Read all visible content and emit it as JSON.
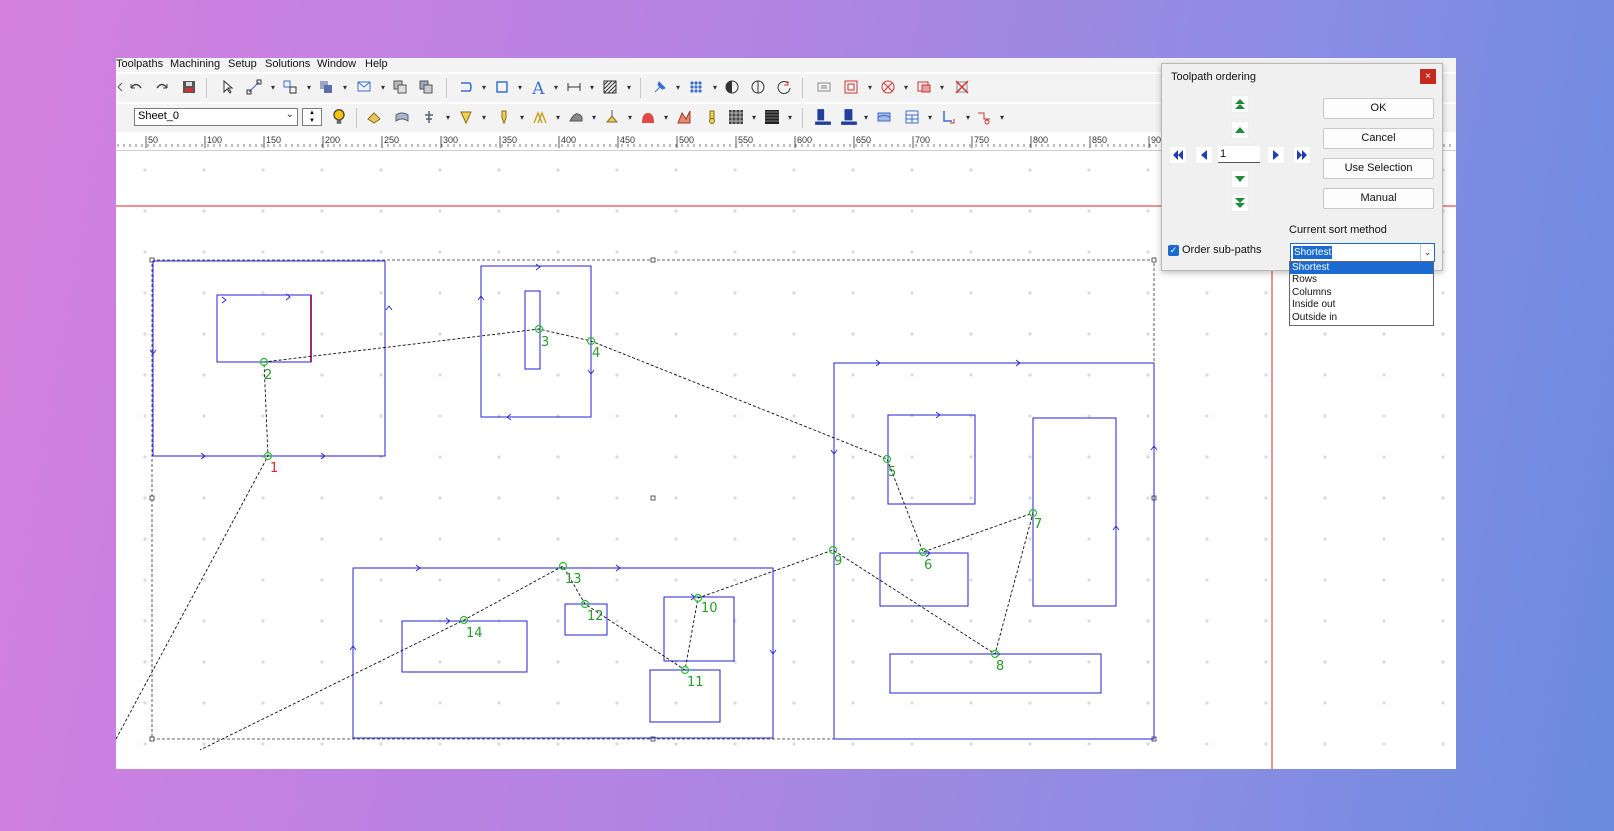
{
  "menu": [
    "Toolpaths",
    "Machining",
    "Setup",
    "Solutions",
    "Window",
    "Help"
  ],
  "toolbar": {
    "sheet_value": "Sheet_0",
    "toolbar1_icons": [
      "undo-arrow-icon",
      "undo-icon",
      "redo-icon",
      "save-icon",
      "select-arrow-icon",
      "node-edit-icon",
      "align-icon",
      "boolean-icon",
      "layers-icon",
      "copy-icon",
      "paste-icon",
      "loop-icon",
      "rectangle-icon",
      "text-icon",
      "dimension-icon",
      "hatch-icon",
      "pin-icon",
      "array-icon",
      "mirror-icon",
      "flip-icon",
      "rotate-icon",
      "weld-icon",
      "offset-icon",
      "trim-icon",
      "combine-icon",
      "delete-icon"
    ],
    "toolbar2_icons": [
      "lightbulb-icon",
      "profile-tool-icon",
      "pocket-tool-icon",
      "drill-tool-icon",
      "vcarve-tool-icon",
      "engrave-tool-icon",
      "chamfer-tool-icon",
      "texture-tool-icon",
      "fluting-tool-icon",
      "moulding-tool-icon",
      "3d-tool-icon",
      "probe-tool-icon",
      "dither-icon",
      "raster-icon",
      "postprocess-icon",
      "output-icon",
      "sheet-icon",
      "nesting-icon",
      "order-icon",
      "tabs-icon"
    ]
  },
  "ruler": {
    "labels": [
      "50",
      "100",
      "150",
      "200",
      "250",
      "300",
      "350",
      "400",
      "450",
      "500",
      "550",
      "600",
      "650",
      "700",
      "750",
      "800",
      "850",
      "90"
    ]
  },
  "canvas": {
    "order_labels": [
      "1",
      "2",
      "3",
      "4",
      "5",
      "6",
      "7",
      "8",
      "9",
      "10",
      "11",
      "12",
      "13",
      "14"
    ],
    "start_color": "#e0261f",
    "order_color": "#2a9a2a",
    "path_color": "#2323d8"
  },
  "dialog": {
    "title": "Toolpath ordering",
    "close": "×",
    "ok": "OK",
    "cancel": "Cancel",
    "use_selection": "Use Selection",
    "manual": "Manual",
    "order_value": "1",
    "sort_label": "Current sort method",
    "subpaths_label": "Order sub-paths",
    "subpaths_checked": true,
    "sort_selected": "Shortest",
    "sort_options": [
      "Shortest",
      "Rows",
      "Columns",
      "Inside out",
      "Outside in"
    ]
  }
}
